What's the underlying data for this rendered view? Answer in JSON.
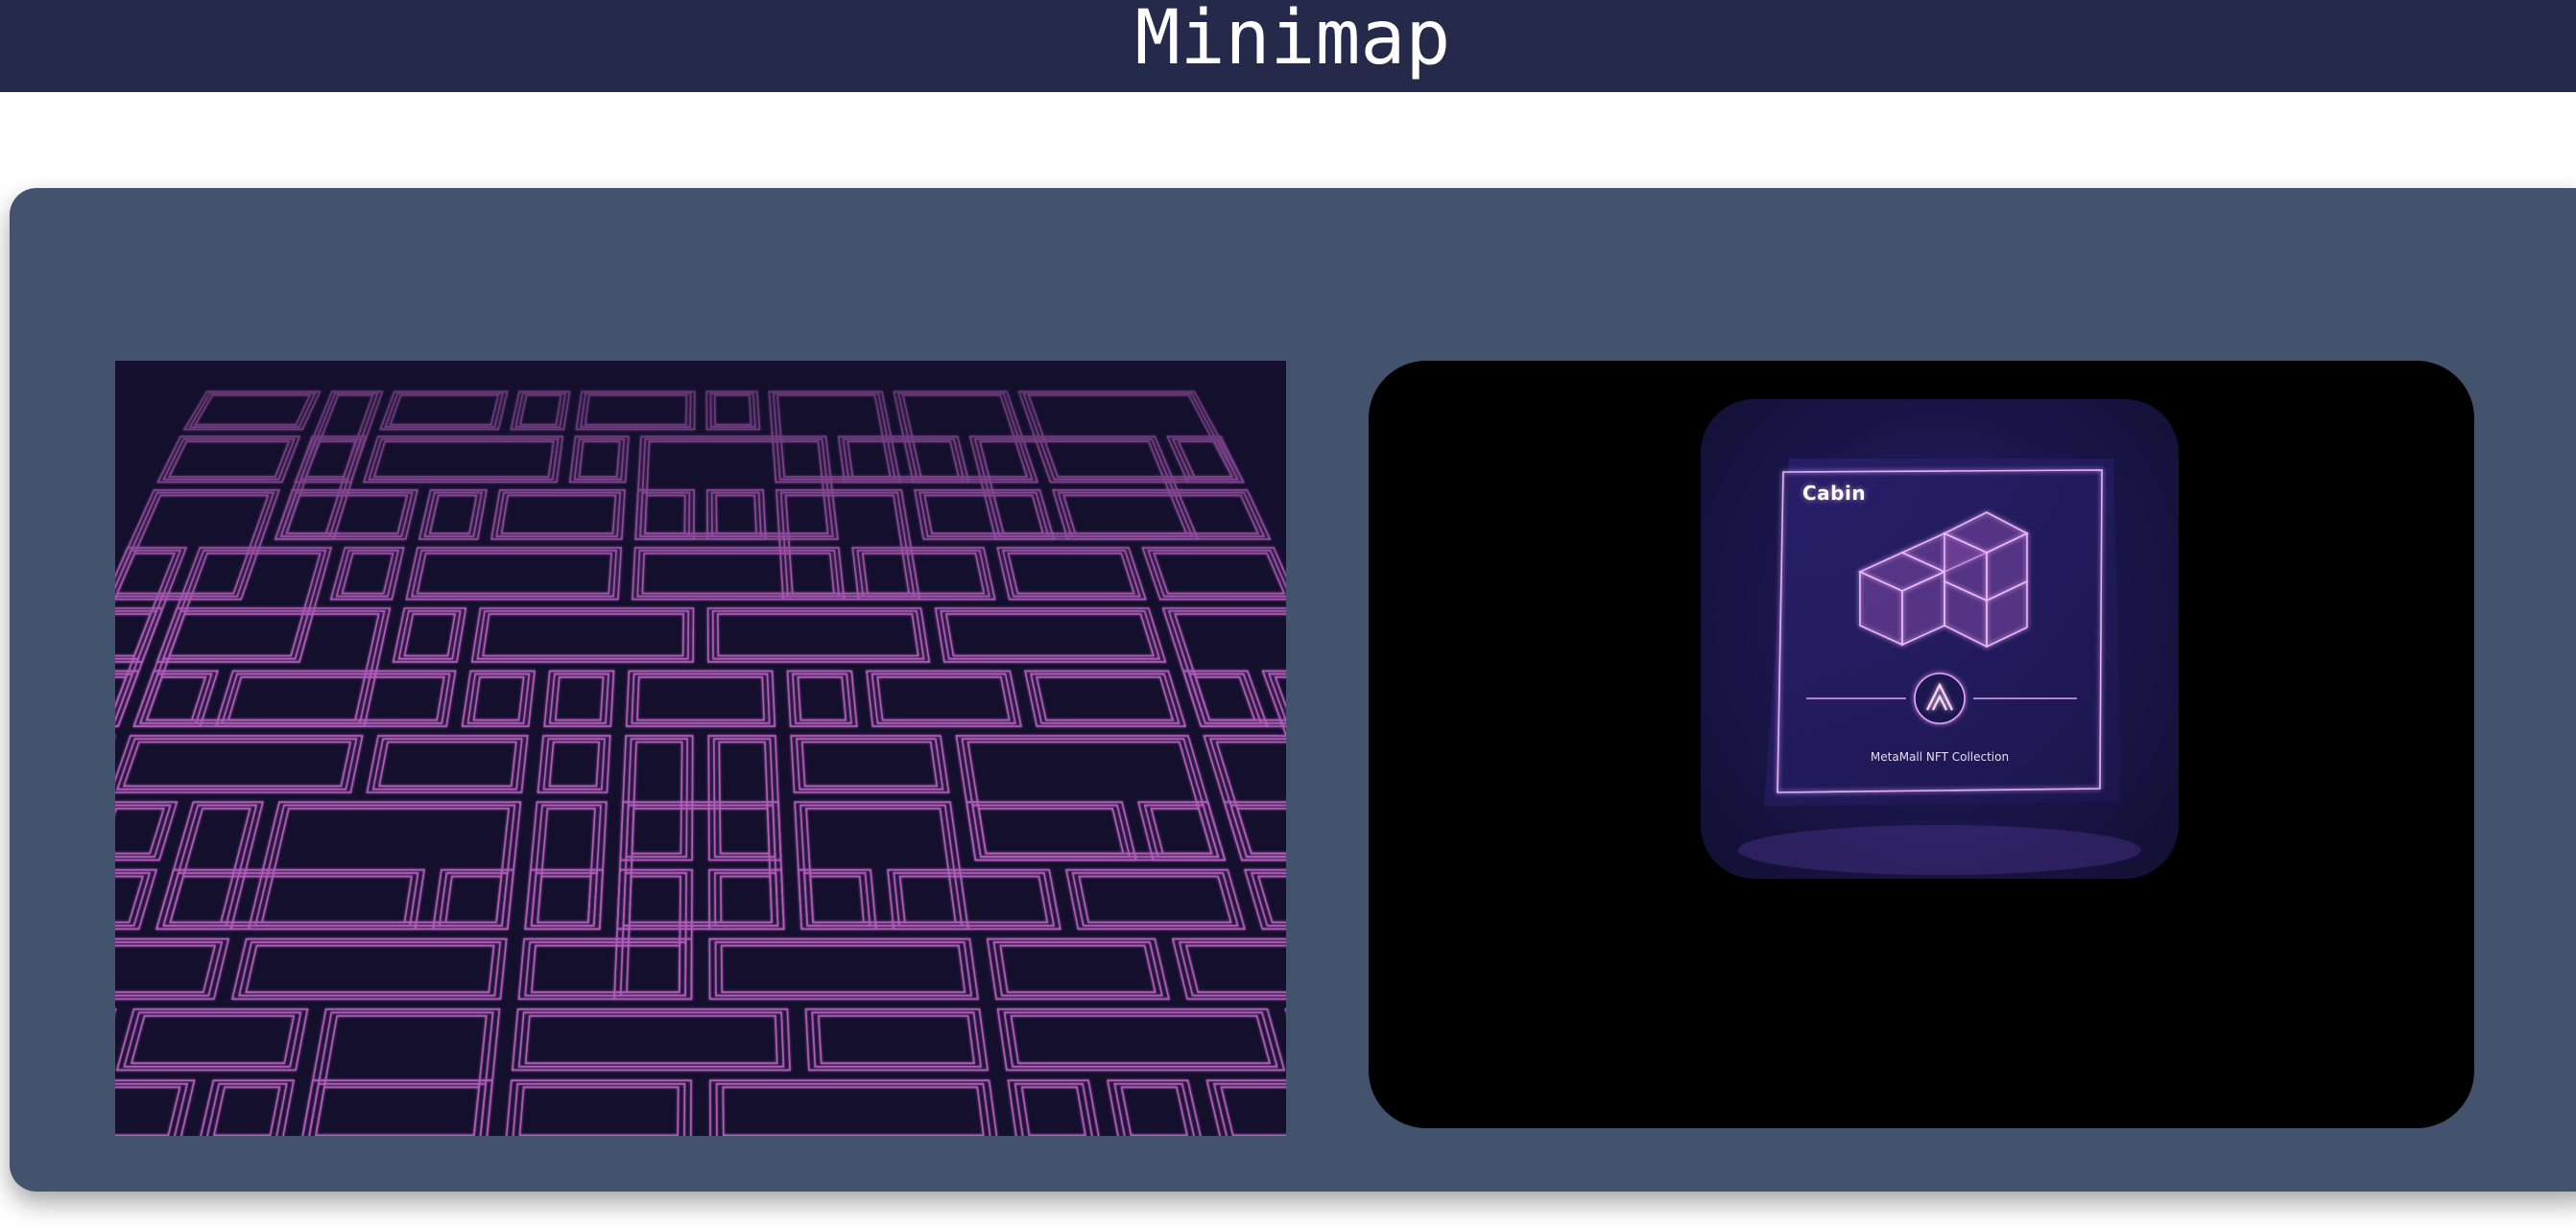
{
  "header": {
    "title": "Minimap"
  },
  "maze": {
    "line_color": "#b05cb8",
    "background": "#130f2c"
  },
  "nft_card": {
    "title": "Cabin",
    "logo_text": "M",
    "subtitle": "MetaMall NFT Collection",
    "accent": "#e6a3ff"
  },
  "colors": {
    "header_bg": "#262a4a",
    "panel_bg": "#44536d",
    "viewer_bg": "#000000",
    "card_bg": "#1a1548"
  }
}
